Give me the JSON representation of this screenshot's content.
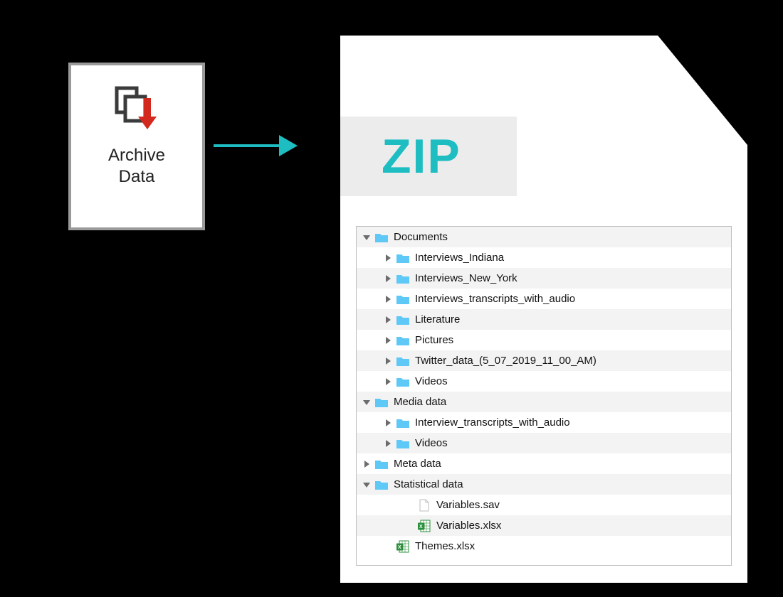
{
  "card": {
    "line1": "Archive",
    "line2": "Data"
  },
  "zip_label": "ZIP",
  "tree": {
    "r0": "Documents",
    "r1": "Interviews_Indiana",
    "r2": "Interviews_New_York",
    "r3": "Interviews_transcripts_with_audio",
    "r4": "Literature",
    "r5": "Pictures",
    "r6": "Twitter_data_(5_07_2019_11_00_AM)",
    "r7": "Videos",
    "r8": "Media data",
    "r9": "Interview_transcripts_with_audio",
    "r10": "Videos",
    "r11": "Meta data",
    "r12": "Statistical data",
    "r13": "Variables.sav",
    "r14": "Variables.xlsx",
    "r15": "Themes.xlsx"
  }
}
